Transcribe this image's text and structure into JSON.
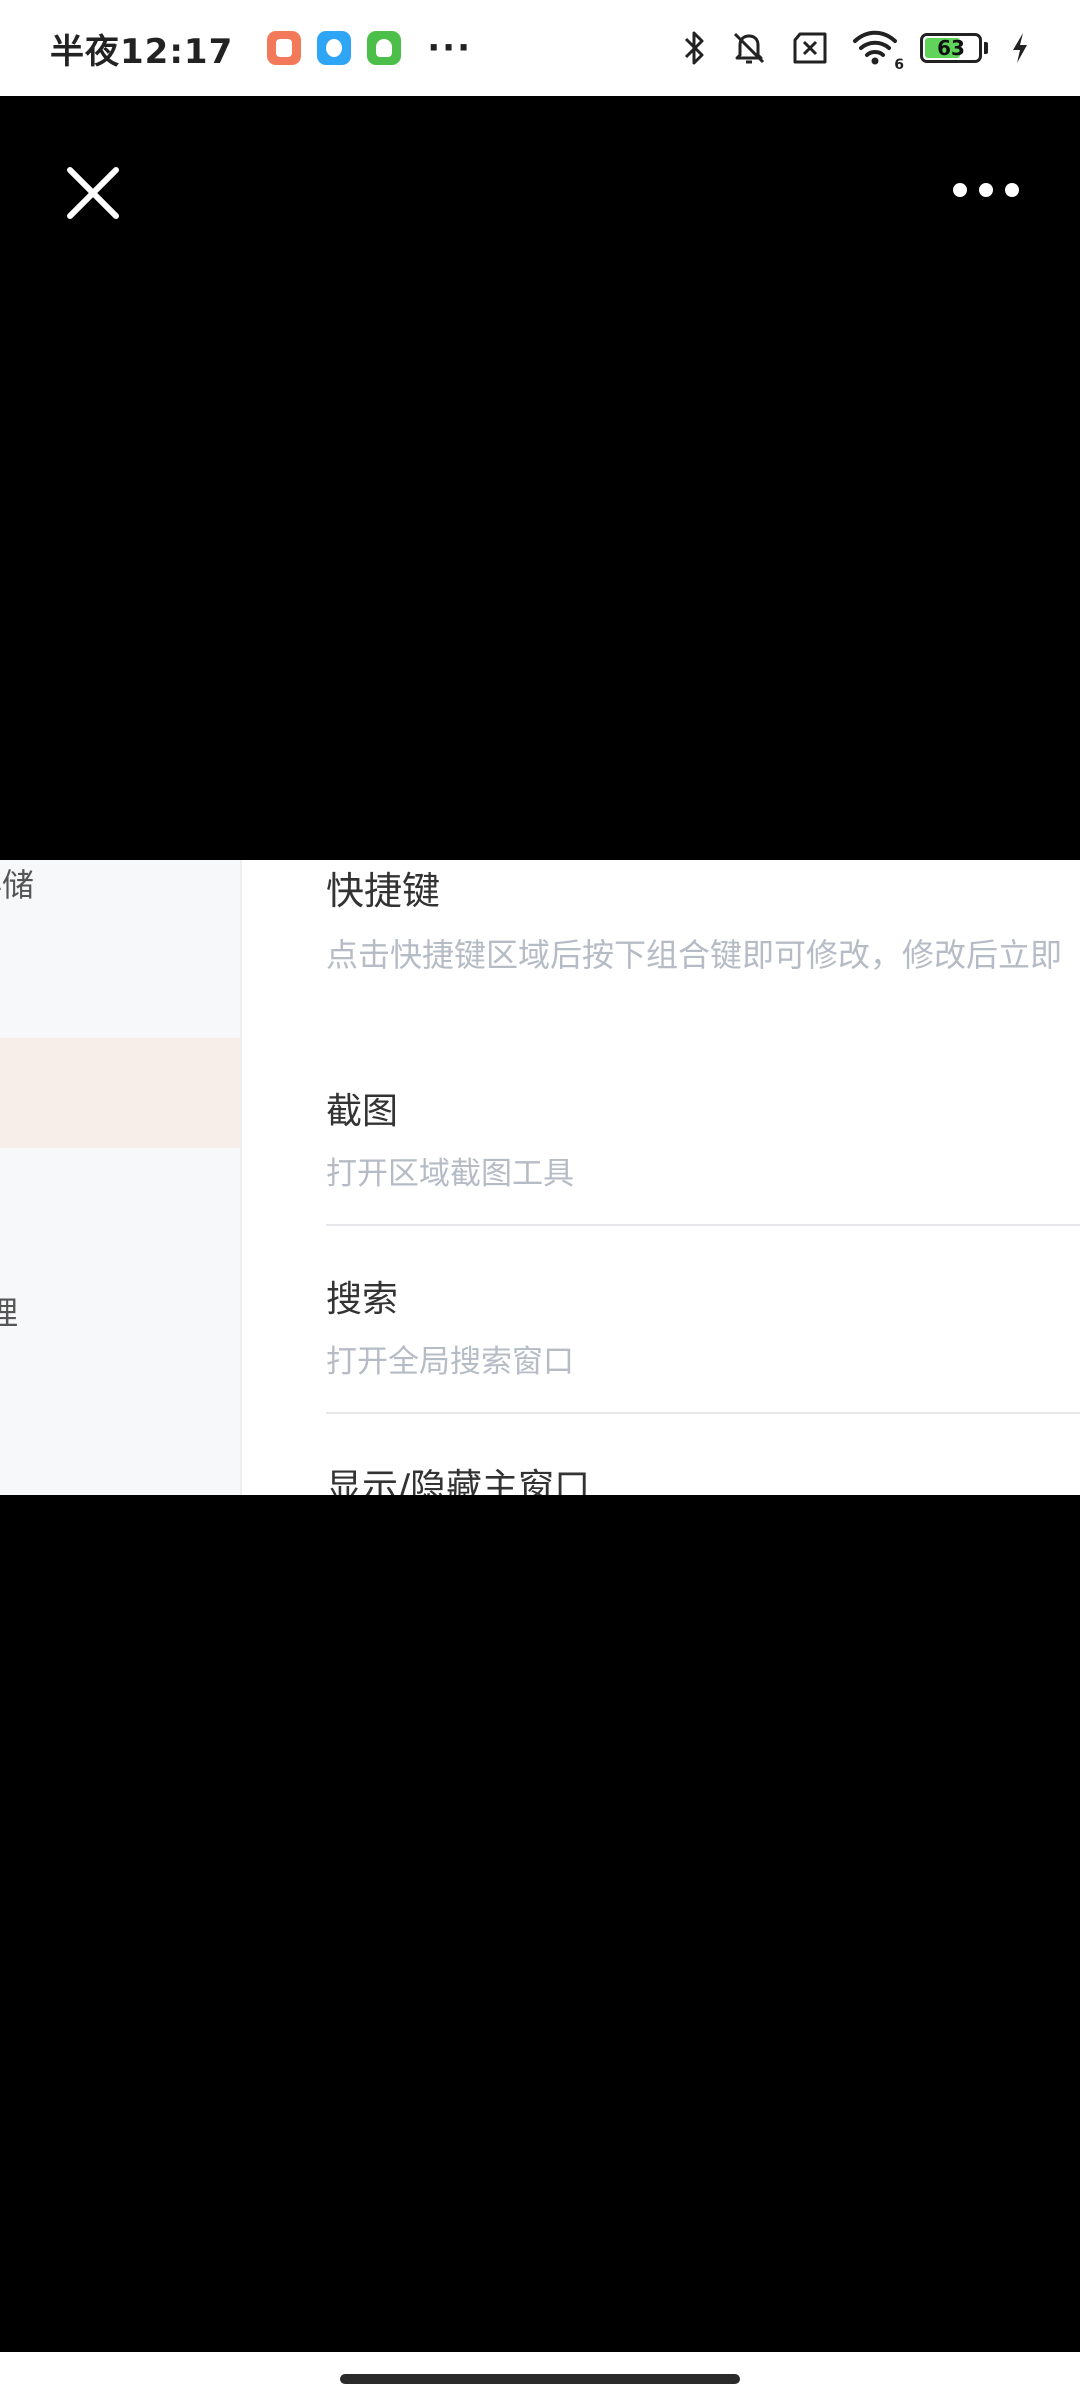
{
  "status_bar": {
    "time": "半夜12:17",
    "overflow": "···",
    "battery_level": "63",
    "battery_fraction": 0.63,
    "notification_apps": [
      "orange-app-icon",
      "blue-app-icon",
      "green-app-icon"
    ],
    "right_icons": [
      "bluetooth-icon",
      "mute-bell-icon",
      "sim-off-icon",
      "wifi-icon",
      "battery-icon",
      "charging-icon"
    ],
    "wifi_badge": "6"
  },
  "viewer": {
    "close_icon": "close-icon",
    "more_icon": "more-icon"
  },
  "screenshot": {
    "sidebar": {
      "item_storage": "存储",
      "item_manage": "理"
    },
    "section": {
      "title": "快捷键",
      "description": "点击快捷键区域后按下组合键即可修改，修改后立即"
    },
    "settings": [
      {
        "title": "截图",
        "description": "打开区域截图工具"
      },
      {
        "title": "搜索",
        "description": "打开全局搜索窗口"
      },
      {
        "title": "显示/隐藏主窗口",
        "description": ""
      }
    ]
  },
  "colors": {
    "background": "#000000",
    "status_bar": "#ffffff",
    "sidebar_bg": "#f7f8fa",
    "sidebar_active": "#f8eee9",
    "title_text": "#333333",
    "desc_text": "#b5bcc6",
    "battery_fill": "#5fd35a"
  }
}
